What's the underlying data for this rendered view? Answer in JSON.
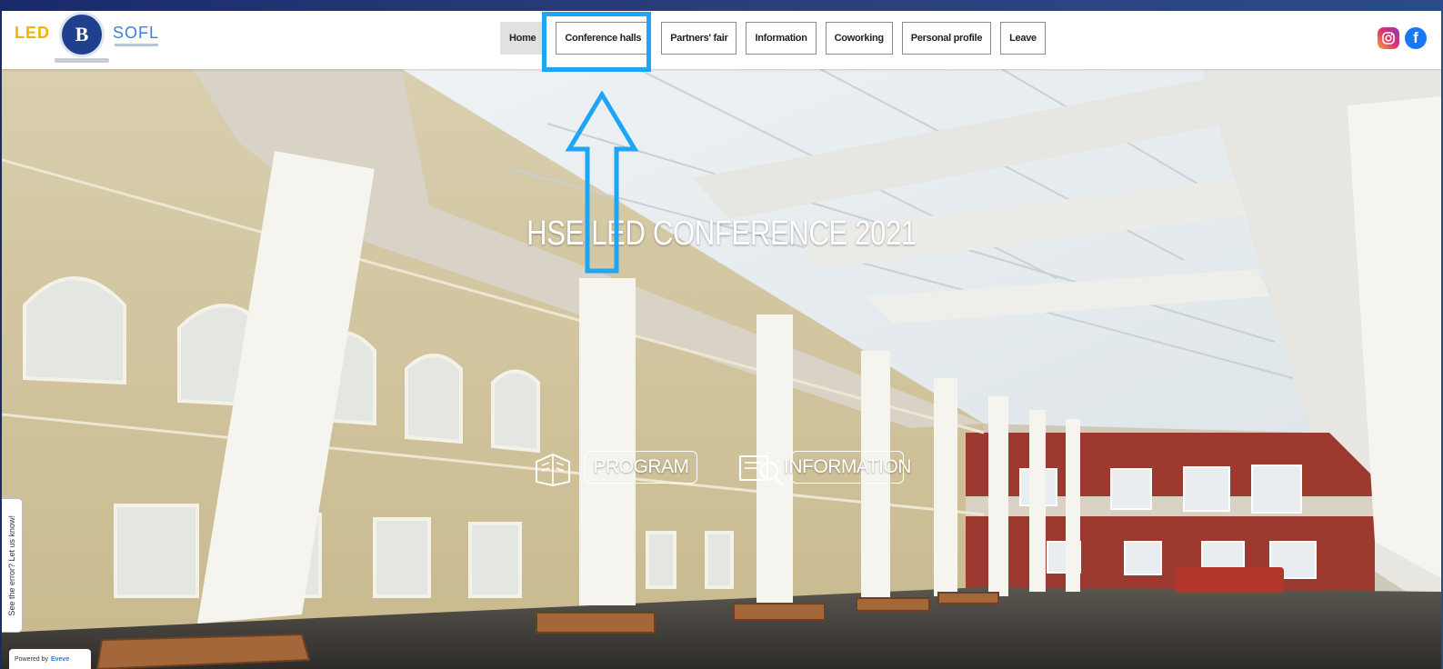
{
  "brand": {
    "led_logo": "LED",
    "hse_logo": "B",
    "sofl_logo": "SOFL"
  },
  "nav": {
    "items": [
      {
        "label": "Home",
        "active": true
      },
      {
        "label": "Conference halls",
        "active": false
      },
      {
        "label": "Partners' fair",
        "active": false
      },
      {
        "label": "Information",
        "active": false
      },
      {
        "label": "Coworking",
        "active": false
      },
      {
        "label": "Personal profile",
        "active": false
      },
      {
        "label": "Leave",
        "active": false
      }
    ],
    "social": [
      "instagram-icon",
      "facebook-icon"
    ],
    "facebook_glyph": "f"
  },
  "hero": {
    "title": "HSE LED CONFERENCE 2021",
    "program_label": "PROGRAM",
    "information_label": "INFORMATION"
  },
  "side": {
    "feedback_text": "See the error? Let us know!",
    "powered_prefix": "Powered by",
    "powered_brand": "Eveve"
  },
  "annotation": {
    "highlight_color": "#1ea5f5"
  }
}
